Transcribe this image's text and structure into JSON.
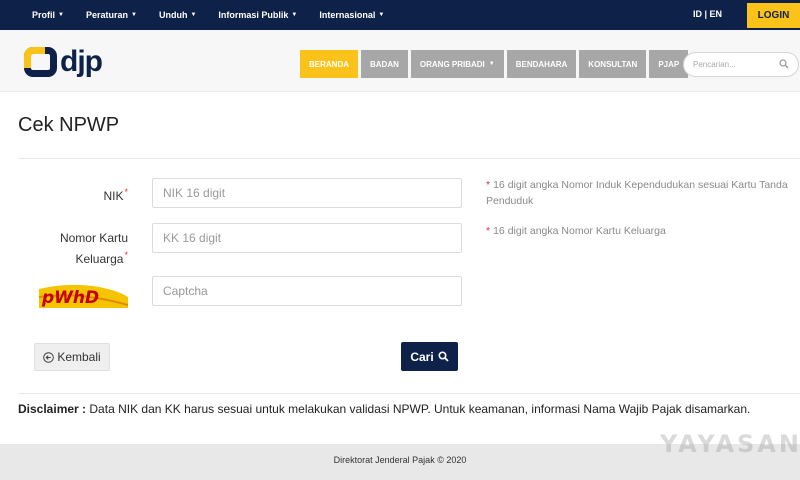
{
  "topbar": {
    "items": [
      {
        "label": "Profil"
      },
      {
        "label": "Peraturan"
      },
      {
        "label": "Unduh"
      },
      {
        "label": "Informasi Publik"
      },
      {
        "label": "Internasional"
      }
    ],
    "lang": "ID | EN",
    "login": "LOGIN",
    "bg_color": "#0e2249",
    "accent_color": "#fbc21a"
  },
  "header": {
    "logo_text": "djp",
    "nav": [
      {
        "label": "BERANDA",
        "active": true
      },
      {
        "label": "BADAN"
      },
      {
        "label": "ORANG PRIBADI",
        "dropdown": true
      },
      {
        "label": "BENDAHARA"
      },
      {
        "label": "KONSULTAN"
      },
      {
        "label": "PJAP"
      }
    ],
    "search_placeholder": "Pencarian..."
  },
  "form": {
    "title": "Cek NPWP",
    "nik": {
      "label": "NIK",
      "placeholder": "NIK 16 digit",
      "hint": "16 digit angka Nomor Induk Kependudukan sesuai Kartu Tanda Penduduk"
    },
    "kk": {
      "label_line1": "Nomor Kartu",
      "label_line2": "Keluarga",
      "placeholder": "KK 16 digit",
      "hint": "16 digit angka Nomor Kartu Keluarga"
    },
    "captcha": {
      "placeholder": "Captcha",
      "image_text": "pWhD"
    },
    "required_mark": "*",
    "back_label": "Kembali",
    "submit_label": "Cari"
  },
  "disclaimer": {
    "label": "Disclaimer :",
    "text": "Data NIK dan KK harus sesuai untuk melakukan validasi NPWP. Untuk keamanan, informasi Nama Wajib Pajak disamarkan."
  },
  "footer": {
    "copyright": "Direktorat Jenderal Pajak © 2020"
  },
  "watermark": "YAYASAN"
}
